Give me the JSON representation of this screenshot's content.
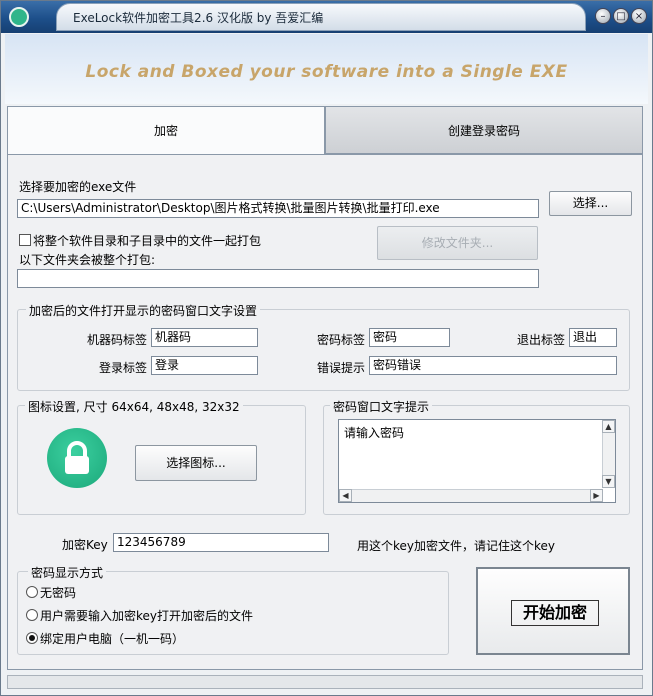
{
  "window": {
    "title": "ExeLock软件加密工具2.6 汉化版 by 吾爱汇编",
    "controls": {
      "minimize": "–",
      "restore": "□",
      "close": "×"
    },
    "icon": "lock-app-icon"
  },
  "banner": {
    "text": "Lock and Boxed your software into a Single EXE",
    "color": "#c8a56a"
  },
  "tabs": [
    {
      "label": "加密",
      "active": true
    },
    {
      "label": "创建登录密码",
      "active": false
    }
  ],
  "exe_section": {
    "label": "选择要加密的exe文件",
    "path_value": "C:\\Users\\Administrator\\Desktop\\图片格式转换\\批量图片转换\\批量打印.exe",
    "select_button": "选择...",
    "include_folders_label": "将整个软件目录和子目录中的文件一起打包",
    "include_folders_checked": false,
    "modify_folder_button": "修改文件夹...",
    "packed_folders_label": "以下文件夹会被整个打包:",
    "packed_folders_value": ""
  },
  "password_window_text": {
    "group_title": "加密后的文件打开显示的密码窗口文字设置",
    "machine_code_label": "机器码标签",
    "machine_code_value": "机器码",
    "password_label": "密码标签",
    "password_value": "密码",
    "exit_label": "退出标签",
    "exit_value": "退出",
    "login_label": "登录标签",
    "login_value": "登录",
    "error_label": "错误提示",
    "error_value": "密码错误"
  },
  "icon_settings": {
    "group_title": "图标设置, 尺寸 64x64, 48x48, 32x32",
    "select_icon_button": "选择图标...",
    "preview_icon": "lock-icon"
  },
  "password_prompt": {
    "group_title": "密码窗口文字提示",
    "text": "请输入密码"
  },
  "encrypt_key": {
    "label": "加密Key",
    "value": "123456789",
    "hint": "用这个key加密文件，请记住这个key"
  },
  "password_mode": {
    "group_title": "密码显示方式",
    "options": [
      {
        "label": "无密码",
        "selected": false
      },
      {
        "label": "用户需要输入加密key打开加密后的文件",
        "selected": false
      },
      {
        "label": "绑定用户电脑（一机一码）",
        "selected": true
      }
    ]
  },
  "start_button": "开始加密"
}
